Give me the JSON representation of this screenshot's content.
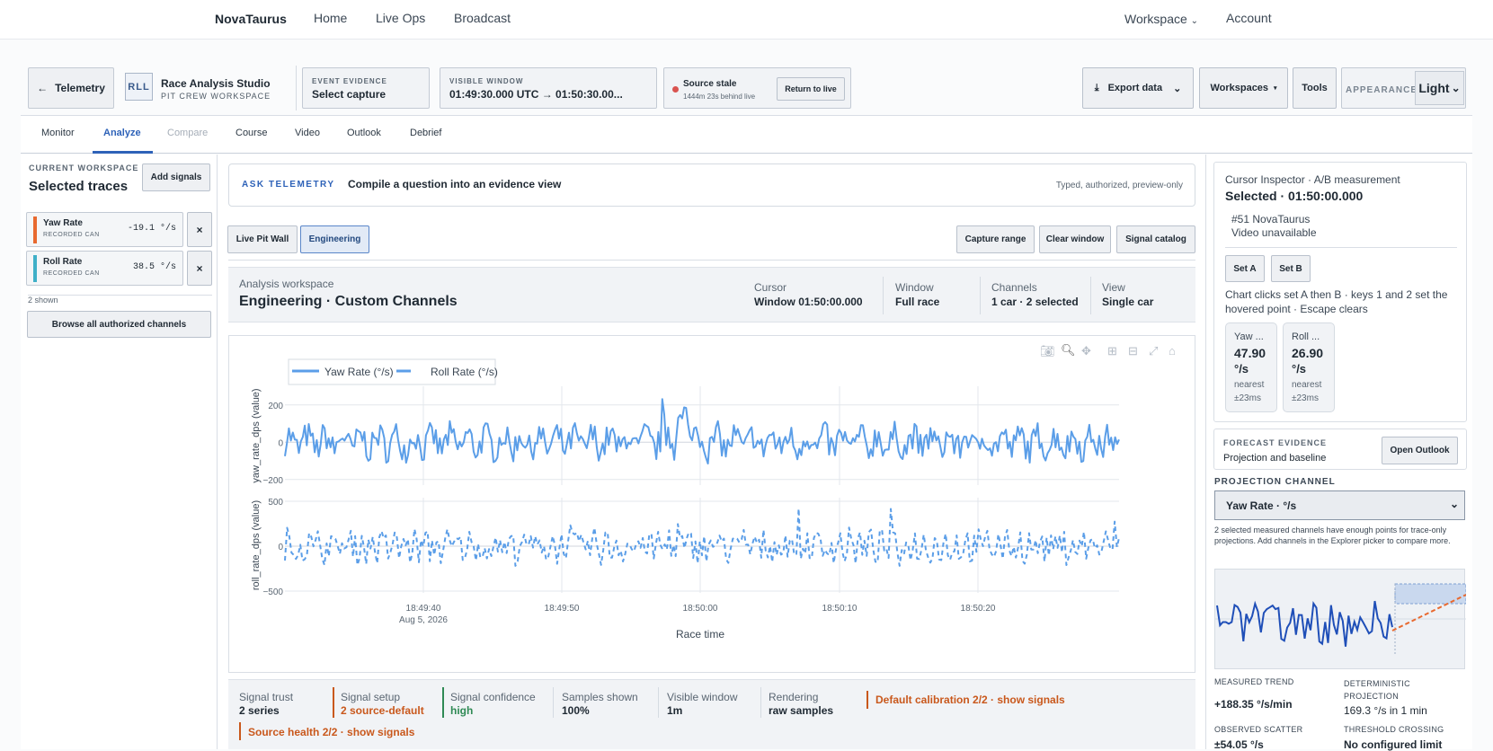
{
  "topnav": {
    "brand": "NovaTaurus",
    "links": [
      "Home",
      "Live Ops",
      "Broadcast"
    ],
    "workspace": "Workspace",
    "workspace_caret": "⌄",
    "account": "Account"
  },
  "toolbar": {
    "back_label": "Telemetry",
    "app_badge": "RLL",
    "app_title": "Race Analysis Studio",
    "app_subtitle": "PIT CREW WORKSPACE",
    "event_evidence_label": "EVENT EVIDENCE",
    "event_evidence_value": "Select capture",
    "visible_window_label": "VISIBLE WINDOW",
    "visible_window_value": "01:49:30.000 UTC → 01:50:30.00...",
    "source_status": "Source stale",
    "source_behind": "1444m 23s behind live",
    "return_live": "Return to live",
    "export": "Export data",
    "workspaces": "Workspaces",
    "tools": "Tools",
    "appearance_label": "APPEARANCE",
    "appearance_value": "Light"
  },
  "tabs": [
    {
      "label": "Monitor",
      "state": "normal"
    },
    {
      "label": "Analyze",
      "state": "active"
    },
    {
      "label": "Compare",
      "state": "disabled"
    },
    {
      "label": "Course",
      "state": "normal"
    },
    {
      "label": "Video",
      "state": "normal"
    },
    {
      "label": "Outlook",
      "state": "normal"
    },
    {
      "label": "Debrief",
      "state": "normal"
    }
  ],
  "left": {
    "current_label": "CURRENT WORKSPACE",
    "title": "Selected traces",
    "add_signals": "Add signals",
    "signals": [
      {
        "name": "Yaw Rate",
        "source": "RECORDED CAN",
        "value": "-19.1 °/s",
        "color": "#e8692f"
      },
      {
        "name": "Roll Rate",
        "source": "RECORDED CAN",
        "value": "38.5 °/s",
        "color": "#3fb0c8"
      }
    ],
    "remove_glyph": "×",
    "shown": "2 shown",
    "browse": "Browse all authorized channels"
  },
  "ask": {
    "label": "ASK TELEMETRY",
    "prompt": "Compile a question into an evidence view",
    "note": "Typed, authorized, preview-only"
  },
  "modes": {
    "live": "Live Pit Wall",
    "engineering": "Engineering",
    "capture": "Capture range",
    "clear": "Clear window",
    "catalog": "Signal catalog"
  },
  "workspace_header": {
    "label": "Analysis workspace",
    "title": "Engineering · Custom Channels",
    "cursor_label": "Cursor",
    "cursor_value": "Window 01:50:00.000",
    "window_label": "Window",
    "window_value": "Full race",
    "channels_label": "Channels",
    "channels_value": "1 car · 2 selected",
    "view_label": "View",
    "view_value": "Single car"
  },
  "chart_data": {
    "type": "line",
    "legend": [
      "Yaw Rate (°/s)",
      "Roll Rate (°/s)"
    ],
    "x_label": "Race time",
    "x_ticks": [
      "18:49:40",
      "18:49:50",
      "18:50:00",
      "18:50:10",
      "18:50:20"
    ],
    "x_date": "Aug 5, 2026",
    "x_range": [
      "18:49:31",
      "18:50:30"
    ],
    "panels": [
      {
        "ylabel": "yaw_rate_dps (value)",
        "yticks": [
          "200",
          "0",
          "−200"
        ],
        "ylim": [
          -230,
          300
        ],
        "style": "solid"
      },
      {
        "ylabel": "roll_rate_dps (value)",
        "yticks": [
          "500",
          "0",
          "−500"
        ],
        "ylim": [
          -520,
          540
        ],
        "style": "dashed"
      }
    ],
    "color": "#5b9ee8",
    "grid": true
  },
  "status": {
    "trust_label": "Signal trust",
    "trust_value": "2 series",
    "setup_label": "Signal setup",
    "setup_value": "2 source-default",
    "conf_label": "Signal confidence",
    "conf_value": "high",
    "samples_label": "Samples shown",
    "samples_value": "100%",
    "window_label": "Visible window",
    "window_value": "1m",
    "render_label": "Rendering",
    "render_value": "raw samples",
    "calib": "Default calibration 2/2 · show signals",
    "health": "Source health 2/2 · show signals"
  },
  "inspector": {
    "title": "Cursor Inspector · A/B measurement",
    "selected": "Selected · 01:50:00.000",
    "car": "#51 NovaTaurus",
    "video": "Video unavailable",
    "set_a": "Set A",
    "set_b": "Set B",
    "help": "Chart clicks set A then B · keys 1 and 2 set the hovered point · Escape clears",
    "cards": [
      {
        "name": "Yaw ...",
        "value": "47.90",
        "unit": "°/s",
        "note1": "nearest",
        "note2": "±23ms"
      },
      {
        "name": "Roll ...",
        "value": "26.90",
        "unit": "°/s",
        "note1": "nearest",
        "note2": "±23ms"
      }
    ]
  },
  "forecast": {
    "label": "FORECAST EVIDENCE",
    "subtitle": "Projection and baseline",
    "open": "Open Outlook",
    "proj_label": "PROJECTION CHANNEL",
    "proj_value": "Yaw Rate · °/s",
    "note": "2 selected measured channels have enough points for trace-only projections. Add channels in the Explorer picker to compare more.",
    "trend_label": "MEASURED TREND",
    "trend_value": "+188.35 °/s/min",
    "det_label": "DETERMINISTIC PROJECTION",
    "det_value": "169.3 °/s in 1 min",
    "scatter_label": "OBSERVED SCATTER",
    "scatter_value": "±54.05 °/s",
    "cross_label": "THRESHOLD CROSSING",
    "cross_value": "No configured limit"
  }
}
